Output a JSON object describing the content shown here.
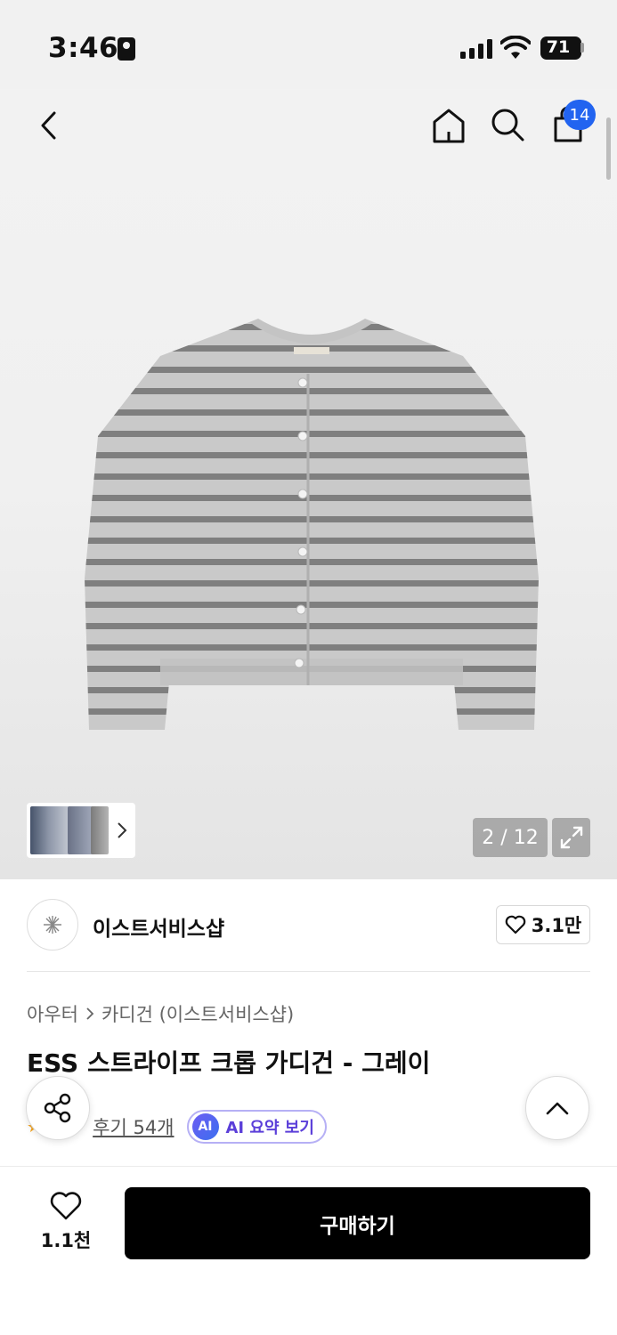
{
  "status_bar": {
    "time": "3:46",
    "battery": "71"
  },
  "header": {
    "cart_count": "14"
  },
  "gallery": {
    "counter": "2 / 12"
  },
  "shop": {
    "name": "이스트서비스샵",
    "likes": "3.1만"
  },
  "breadcrumb": {
    "category": "아우터",
    "subcategory": "카디건 (이스트서비스샵)"
  },
  "product": {
    "title": "ESS 스트라이프 크롭 가디건 - 그레이",
    "review_link": "후기 54개",
    "ai_badge": "AI",
    "ai_summary": "AI 요약 보기"
  },
  "bottom_bar": {
    "wishlist_count": "1.1천",
    "buy_label": "구매하기"
  },
  "colors": {
    "accent_blue": "#2264f0",
    "buy_button": "#000000",
    "ai_purple": "#5b3fd9",
    "star": "#f5a623"
  }
}
